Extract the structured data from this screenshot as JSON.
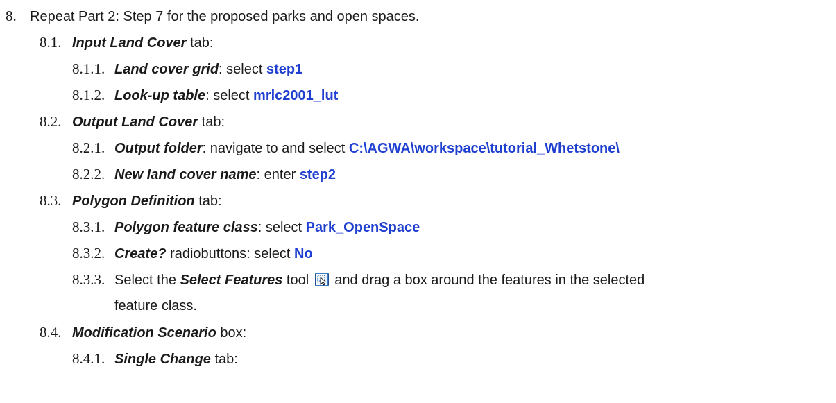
{
  "items": [
    {
      "num": "8.",
      "text": "Repeat Part 2: Step 7 for the proposed parks and open spaces."
    },
    {
      "num": "8.1.",
      "term": "Input Land Cover",
      "rest": " tab:"
    },
    {
      "num": "8.1.1.",
      "term": "Land cover grid",
      "mid": ": select ",
      "value": "step1"
    },
    {
      "num": "8.1.2.",
      "term": "Look-up table",
      "mid": ": select ",
      "value": "mrlc2001_lut"
    },
    {
      "num": "8.2.",
      "term": "Output Land Cover",
      "rest": " tab:"
    },
    {
      "num": "8.2.1.",
      "term": "Output folder",
      "mid": ": navigate to and select ",
      "value": "C:\\AGWA\\workspace\\tutorial_Whetstone\\"
    },
    {
      "num": "8.2.2.",
      "term": "New land cover name",
      "mid": ": enter ",
      "value": "step2"
    },
    {
      "num": "8.3.",
      "term": "Polygon Definition",
      "rest": " tab:"
    },
    {
      "num": "8.3.1.",
      "term": "Polygon feature class",
      "mid": ": select ",
      "value": "Park_OpenSpace"
    },
    {
      "num": "8.3.2.",
      "term": "Create?",
      "mid": " radiobuttons: select ",
      "value": "No"
    },
    {
      "num": "8.3.3.",
      "pre": "Select the ",
      "term": "Select Features",
      "mid": " tool",
      "after": " and drag a box around the features in the selected",
      "cont": "feature class."
    },
    {
      "num": "8.4.",
      "term": "Modification Scenario",
      "rest": " box:"
    },
    {
      "num": "8.4.1.",
      "term": "Single Change",
      "rest": " tab:"
    }
  ],
  "icons": {
    "select_features_tool": "select-features-tool-icon"
  }
}
